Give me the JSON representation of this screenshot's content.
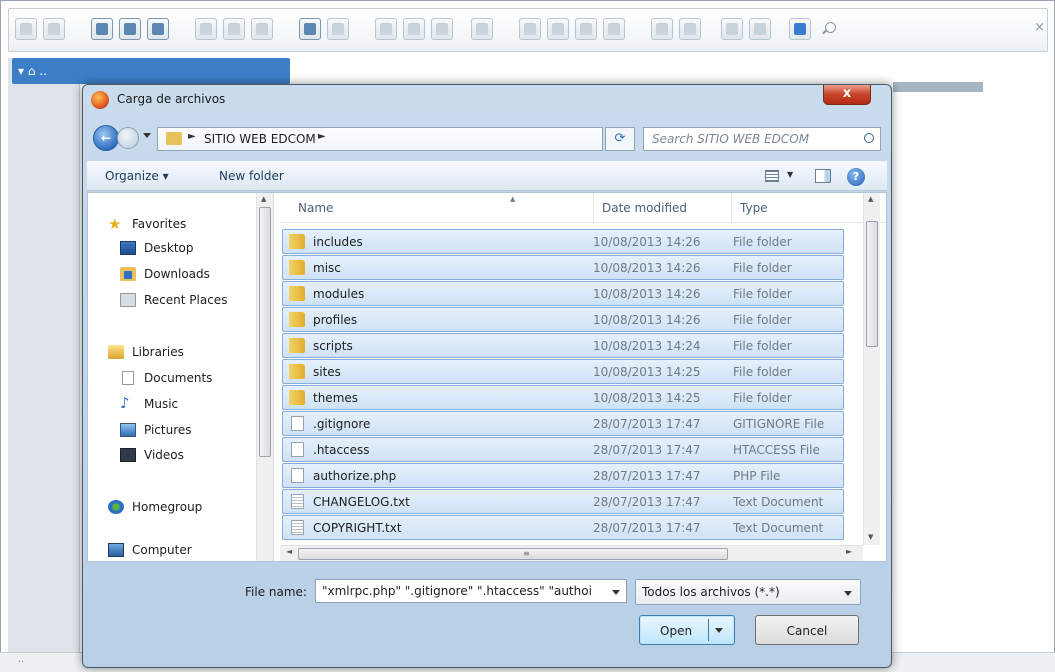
{
  "dialog": {
    "title": "Carga de archivos",
    "close_label": "x",
    "breadcrumb": "SITIO WEB EDCOM",
    "breadcrumb_sep": "►",
    "search_placeholder": "Search SITIO WEB EDCOM",
    "commands": {
      "organize": "Organize ▾",
      "new_folder": "New folder"
    },
    "nav": [
      {
        "label": "Favorites",
        "icon": "star-icon"
      },
      {
        "label": "Desktop",
        "icon": "desktop-icon"
      },
      {
        "label": "Downloads",
        "icon": "downloads-icon"
      },
      {
        "label": "Recent Places",
        "icon": "recent-places-icon"
      },
      {
        "label": "Libraries",
        "icon": "libraries-icon"
      },
      {
        "label": "Documents",
        "icon": "documents-icon"
      },
      {
        "label": "Music",
        "icon": "music-icon"
      },
      {
        "label": "Pictures",
        "icon": "pictures-icon"
      },
      {
        "label": "Videos",
        "icon": "videos-icon"
      },
      {
        "label": "Homegroup",
        "icon": "homegroup-icon"
      },
      {
        "label": "Computer",
        "icon": "computer-icon"
      }
    ],
    "columns": {
      "name": "Name",
      "date": "Date modified",
      "type": "Type"
    },
    "files": [
      {
        "name": "includes",
        "date": "10/08/2013 14:26",
        "type": "File folder",
        "kind": "folder",
        "selected": true
      },
      {
        "name": "misc",
        "date": "10/08/2013 14:26",
        "type": "File folder",
        "kind": "folder",
        "selected": true
      },
      {
        "name": "modules",
        "date": "10/08/2013 14:26",
        "type": "File folder",
        "kind": "folder",
        "selected": true
      },
      {
        "name": "profiles",
        "date": "10/08/2013 14:26",
        "type": "File folder",
        "kind": "folder",
        "selected": true
      },
      {
        "name": "scripts",
        "date": "10/08/2013 14:24",
        "type": "File folder",
        "kind": "folder",
        "selected": true
      },
      {
        "name": "sites",
        "date": "10/08/2013 14:25",
        "type": "File folder",
        "kind": "folder",
        "selected": true
      },
      {
        "name": "themes",
        "date": "10/08/2013 14:25",
        "type": "File folder",
        "kind": "folder",
        "selected": true
      },
      {
        "name": ".gitignore",
        "date": "28/07/2013 17:47",
        "type": "GITIGNORE File",
        "kind": "file",
        "selected": true
      },
      {
        "name": ".htaccess",
        "date": "28/07/2013 17:47",
        "type": "HTACCESS File",
        "kind": "file",
        "selected": true
      },
      {
        "name": "authorize.php",
        "date": "28/07/2013 17:47",
        "type": "PHP File",
        "kind": "file",
        "selected": true
      },
      {
        "name": "CHANGELOG.txt",
        "date": "28/07/2013 17:47",
        "type": "Text Document",
        "kind": "text",
        "selected": true
      },
      {
        "name": "COPYRIGHT.txt",
        "date": "28/07/2013 17:47",
        "type": "Text Document",
        "kind": "text",
        "selected": true
      }
    ],
    "file_name_label": "File name:",
    "file_name_value": "\"xmlrpc.php\" \".gitignore\" \".htaccess\" \"authoi",
    "filter_value": "Todos los archivos (*.*)",
    "open_label": "Open",
    "cancel_label": "Cancel"
  },
  "status": {
    "dots": ".."
  },
  "colors": {
    "accent": "#3c7fc8",
    "selection": "#cfe2f6",
    "close": "#c7432b"
  }
}
